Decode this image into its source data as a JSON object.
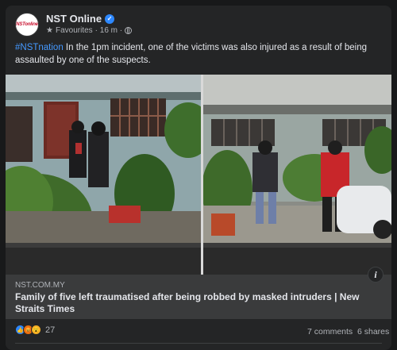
{
  "post": {
    "page_name": "NST Online",
    "avatar_text": "NSTonline",
    "meta_favourites": "Favourites",
    "meta_time": "· 16 m ·",
    "hashtag": "#NSTnation",
    "body": " In the 1pm incident, one of the victims was also injured as a result of being assaulted by one of the suspects."
  },
  "link": {
    "domain": "NST.COM.MY",
    "title": "Family of five left traumatised after being robbed by masked intruders | New Straits Times"
  },
  "stats": {
    "reaction_count": "27",
    "comments": "7 comments",
    "shares": "6 shares"
  },
  "icons": {
    "verified": "verified-badge-icon",
    "favourites": "star-icon",
    "audience": "globe-icon",
    "info": "info-icon",
    "reactions": [
      "like-reaction-icon",
      "angry-reaction-icon",
      "wow-reaction-icon"
    ]
  },
  "colors": {
    "background": "#18191a",
    "card": "#242526",
    "link_preview": "#3a3b3c",
    "hashtag": "#4599ff",
    "brand_red": "#c8102e"
  }
}
